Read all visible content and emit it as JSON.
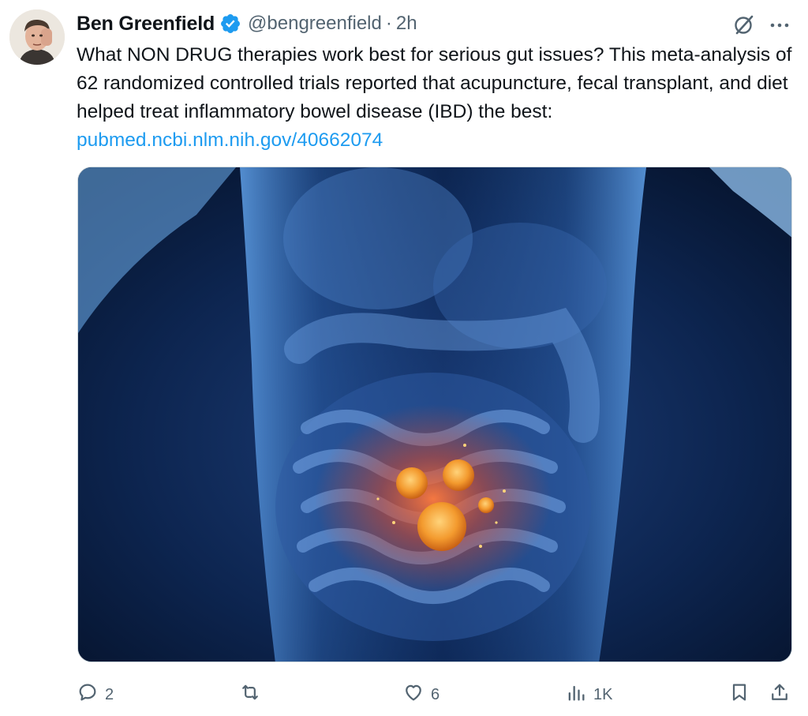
{
  "author": {
    "name": "Ben Greenfield",
    "handle": "@bengreenfield",
    "separator": "·",
    "time": "2h",
    "verified": true
  },
  "tweet": {
    "text": "What NON DRUG therapies work best for serious gut issues? This meta-analysis of 62 randomized controlled trials reported that acupuncture, fecal transplant, and diet helped treat inflammatory bowel disease (IBD) the best: ",
    "link_text": "pubmed.ncbi.nlm.nih.gov/40662074"
  },
  "actions": {
    "replies": "2",
    "retweets": "",
    "likes": "6",
    "views": "1K"
  },
  "colors": {
    "text": "#0f1419",
    "secondary": "#536471",
    "link": "#1d9bf0",
    "verified": "#1d9bf0"
  },
  "icons": {
    "verified": "verified-badge-icon",
    "grok": "grok-icon",
    "more": "more-icon",
    "reply": "reply-icon",
    "retweet": "retweet-icon",
    "like": "heart-icon",
    "views": "analytics-icon",
    "bookmark": "bookmark-icon",
    "share": "share-icon"
  }
}
